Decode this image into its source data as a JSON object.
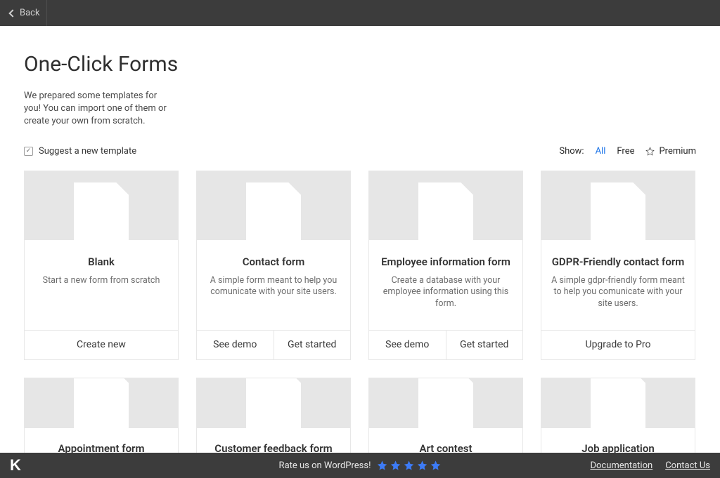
{
  "topBar": {
    "back": "Back"
  },
  "header": {
    "title": "One-Click Forms",
    "intro": "We prepared some templates for you! You can import one of them or create your own from scratch.",
    "suggest": "Suggest a new template"
  },
  "filter": {
    "label": "Show:",
    "all": "All",
    "free": "Free",
    "premium": "Premium"
  },
  "cards": [
    {
      "title": "Blank",
      "desc": "Start a new form from scratch",
      "actions": [
        "Create new"
      ]
    },
    {
      "title": "Contact form",
      "desc": "A simple form meant to help you comunicate with your site users.",
      "actions": [
        "See demo",
        "Get started"
      ]
    },
    {
      "title": "Employee information form",
      "desc": "Create a database with your employee information using this form.",
      "actions": [
        "See demo",
        "Get started"
      ]
    },
    {
      "title": "GDPR-Friendly contact form",
      "desc": "A simple gdpr-friendly form meant to help you comunicate with your site users.",
      "actions": [
        "Upgrade to Pro"
      ]
    }
  ],
  "cutCards": [
    {
      "title": "Appointment form"
    },
    {
      "title": "Customer feedback form"
    },
    {
      "title": "Art contest"
    },
    {
      "title": "Job application"
    }
  ],
  "bottom": {
    "rate": "Rate us on WordPress!",
    "doc": "Documentation",
    "contact": "Contact Us"
  }
}
